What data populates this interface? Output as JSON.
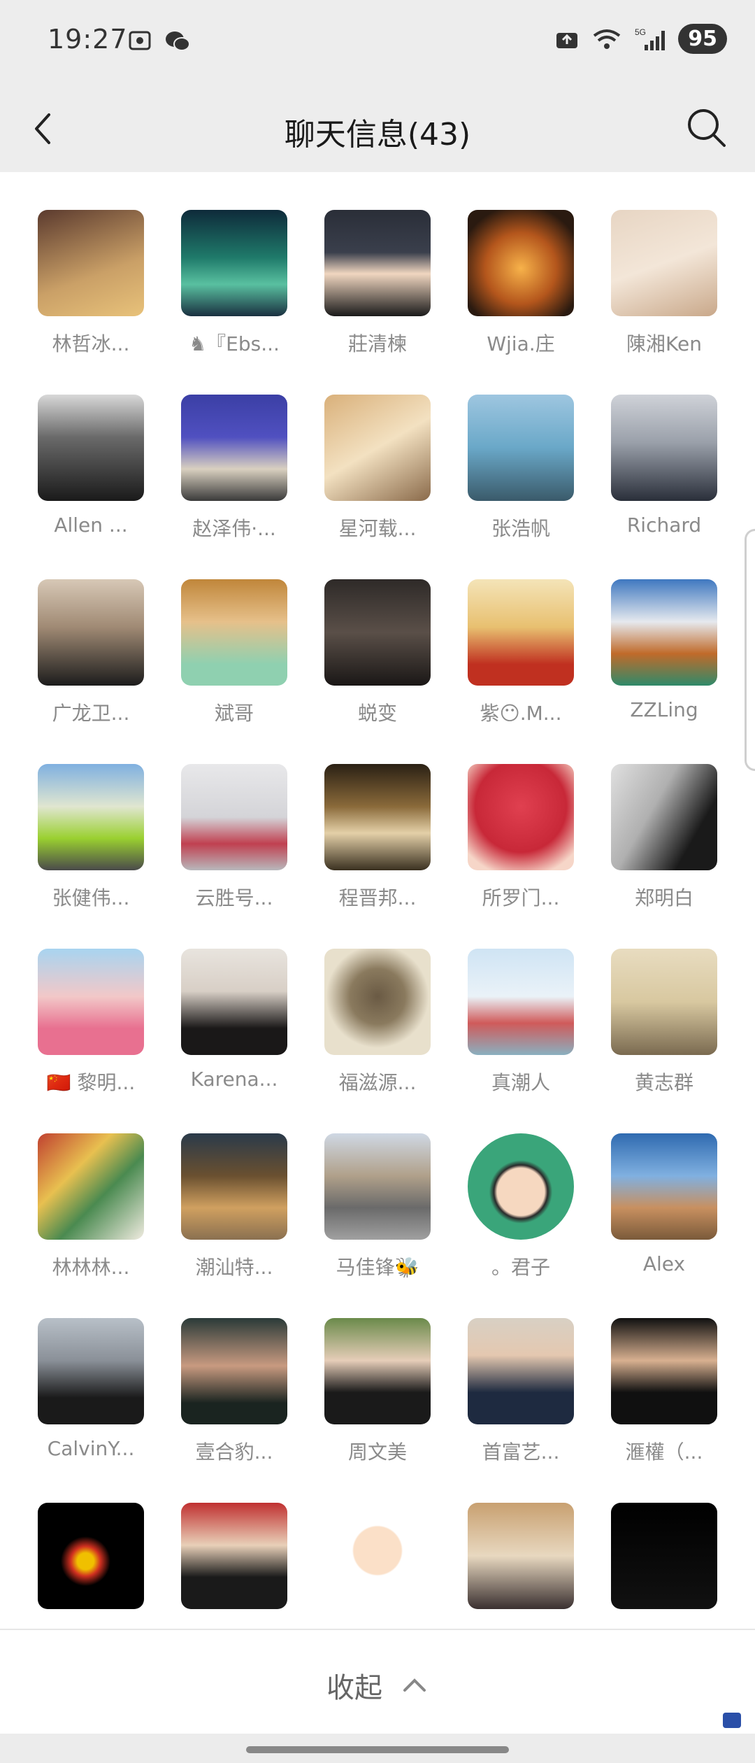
{
  "status_bar": {
    "time": "19:27",
    "battery": "95",
    "network": "5G"
  },
  "header": {
    "title": "聊天信息(43)"
  },
  "members": [
    {
      "name": "林哲冰...",
      "bg": "linear-gradient(160deg,#5b3a2e,#caa067 60%,#e8c27a)"
    },
    {
      "name": "♞『Ebs...",
      "bg": "linear-gradient(180deg,#0e2a3a,#1f7a6a 45%,#59c0a0 70%,#1a3040)"
    },
    {
      "name": "莊清楝",
      "bg": "linear-gradient(180deg,#2a2e38,#3a3f4c 40%,#f0d6c0 60%,#1a1a1a)"
    },
    {
      "name": "Wjia.庄",
      "bg": "radial-gradient(circle at 50% 55%,#f7b24a,#b4561c 45%,#2a1a10 80%)"
    },
    {
      "name": "陳湘Ken",
      "bg": "linear-gradient(160deg,#e7d5c3,#f3e6d8 50%,#c9a88a)"
    },
    {
      "name": "Allen ...",
      "bg": "linear-gradient(180deg,#d8d8d8,#6a6a6a 40%,#1a1a1a)"
    },
    {
      "name": "赵泽伟·...",
      "bg": "linear-gradient(180deg,#3b3fa5,#5050c0 40%,#d9d0c0 70%,#3a3a3a)"
    },
    {
      "name": "星河载...",
      "bg": "linear-gradient(150deg,#d9b07a,#f3e1c1 50%,#8a6a4a)"
    },
    {
      "name": "张浩帆",
      "bg": "linear-gradient(180deg,#9ec6e0,#6aa8c8 50%,#3a5a6a)"
    },
    {
      "name": "Richard",
      "bg": "linear-gradient(180deg,#cfd2d8,#9aa0aa 45%,#2a2f3a)"
    },
    {
      "name": "广龙卫...",
      "bg": "linear-gradient(180deg,#d7c8b6,#a08a74 45%,#1c1c1c)"
    },
    {
      "name": "斌哥",
      "bg": "linear-gradient(180deg,#c0863a,#e6c08a 40%,#8fd0b0 80%)"
    },
    {
      "name": "蜕变",
      "bg": "linear-gradient(180deg,#2e2a28,#5a4f48 50%,#1a1716)"
    },
    {
      "name": "紫😶.M...",
      "bg": "linear-gradient(180deg,#f4e4b8,#e8c070 45%,#c03020 80%)"
    },
    {
      "name": "ZZLing",
      "bg": "linear-gradient(180deg,#3f78c0,#e6e9ee 40%,#c06a2a 70%,#2f8a6a)"
    },
    {
      "name": "张健伟...",
      "bg": "linear-gradient(180deg,#7fb0e0,#e0e6d0 40%,#9ad030 70%,#4a4a4a)"
    },
    {
      "name": "云胜号...",
      "bg": "linear-gradient(180deg,#e8e8ea,#d4d4d8 50%,#c04050 75%,#b8b8bc)"
    },
    {
      "name": "程晋邦...",
      "bg": "linear-gradient(180deg,#2a2014,#8a6a3a 40%,#e4d0a8 65%,#3a3020)"
    },
    {
      "name": "所罗门...",
      "bg": "radial-gradient(circle at 50% 40%,#e04050,#c82838 55%,#f6d6c8 85%)"
    },
    {
      "name": "郑明白",
      "bg": "linear-gradient(120deg,#e0e0e0,#b0b0b0 40%,#1a1a1a 75%)"
    },
    {
      "name": "🇨🇳 黎明...",
      "bg": "linear-gradient(180deg,#a8d4f0,#f2c8c8 45%,#e87090 75%)"
    },
    {
      "name": "Karena...",
      "bg": "linear-gradient(180deg,#e8e4de,#d8cfc6 40%,#1a1818 75%)"
    },
    {
      "name": "福滋源...",
      "bg": "radial-gradient(circle at 50% 45%,#6a5a44,#8a7a5e 35%,#e8e0cc 65%)"
    },
    {
      "name": "真潮人",
      "bg": "linear-gradient(180deg,#cfe4f4,#eaf2f8 45%,#d05a5a 70%,#8ab0c0)"
    },
    {
      "name": "黄志群",
      "bg": "linear-gradient(180deg,#e8dcc0,#d8c8a0 50%,#7a6a50)"
    },
    {
      "name": "林林林...",
      "bg": "linear-gradient(135deg,#c04030,#e8c050 35%,#4a8a50 60%,#f0ebe0)"
    },
    {
      "name": "潮汕特...",
      "bg": "linear-gradient(180deg,#2a3a4a,#6a5030 40%,#d0a060 70%,#8a7050)"
    },
    {
      "name": "马佳锋🐝",
      "bg": "linear-gradient(180deg,#cfd8e4,#b0a08a 40%,#6a6a6a 70%,#a0a0a0)"
    },
    {
      "name": "。君子",
      "bg": "radial-gradient(circle at 50% 55%,#f6d8c0 30%,#2a2a2a 34%,#3aa57a 40%)",
      "round": true
    },
    {
      "name": "Alex",
      "bg": "linear-gradient(180deg,#2f6ab0,#80b0e0 40%,#c89060 70%,#7a5a3a)"
    },
    {
      "name": "CalvinY...",
      "bg": "linear-gradient(180deg,#b8c0c8,#8a9098 40%,#1a1a1a 75%)"
    },
    {
      "name": "壹合豹...",
      "bg": "linear-gradient(180deg,#2a3a38,#c89a80 45%,#1a2420 80%)"
    },
    {
      "name": "周文美",
      "bg": "linear-gradient(180deg,#6a8a4a,#e6cdb8 40%,#1a1a1a 70%)"
    },
    {
      "name": "首富艺...",
      "bg": "linear-gradient(180deg,#d8d0c4,#e4c8b0 35%,#1e2a40 70%)"
    },
    {
      "name": "滙權（...",
      "bg": "linear-gradient(180deg,#101010,#d8b090 40%,#101010 70%)"
    },
    {
      "name": "",
      "bg": "radial-gradient(circle at 45% 55%,#f0c000 10%,#d03020 18%,#000 30%)"
    },
    {
      "name": "",
      "bg": "linear-gradient(180deg,#c03030,#e8d0b8 40%,#1a1a1a 70%)"
    },
    {
      "name": "",
      "bg": "radial-gradient(circle at 50% 45%,#fbe0c8 30%,#fff 32%)"
    },
    {
      "name": "",
      "bg": "linear-gradient(180deg,#c8a070,#e8d8c0 50%,#3a3030)"
    },
    {
      "name": "",
      "bg": "linear-gradient(180deg,#000,#111)"
    }
  ],
  "footer": {
    "collapse_label": "收起"
  }
}
